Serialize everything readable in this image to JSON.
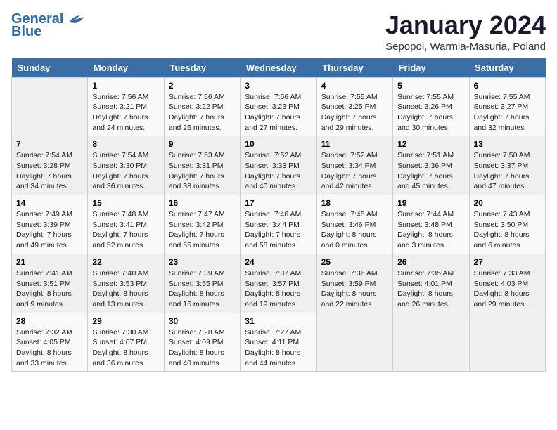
{
  "header": {
    "logo_line1": "General",
    "logo_line2": "Blue",
    "title": "January 2024",
    "subtitle": "Sepopol, Warmia-Masuria, Poland"
  },
  "days_of_week": [
    "Sunday",
    "Monday",
    "Tuesday",
    "Wednesday",
    "Thursday",
    "Friday",
    "Saturday"
  ],
  "weeks": [
    [
      {
        "day": "",
        "info": ""
      },
      {
        "day": "1",
        "info": "Sunrise: 7:56 AM\nSunset: 3:21 PM\nDaylight: 7 hours\nand 24 minutes."
      },
      {
        "day": "2",
        "info": "Sunrise: 7:56 AM\nSunset: 3:22 PM\nDaylight: 7 hours\nand 26 minutes."
      },
      {
        "day": "3",
        "info": "Sunrise: 7:56 AM\nSunset: 3:23 PM\nDaylight: 7 hours\nand 27 minutes."
      },
      {
        "day": "4",
        "info": "Sunrise: 7:55 AM\nSunset: 3:25 PM\nDaylight: 7 hours\nand 29 minutes."
      },
      {
        "day": "5",
        "info": "Sunrise: 7:55 AM\nSunset: 3:26 PM\nDaylight: 7 hours\nand 30 minutes."
      },
      {
        "day": "6",
        "info": "Sunrise: 7:55 AM\nSunset: 3:27 PM\nDaylight: 7 hours\nand 32 minutes."
      }
    ],
    [
      {
        "day": "7",
        "info": "Sunrise: 7:54 AM\nSunset: 3:28 PM\nDaylight: 7 hours\nand 34 minutes."
      },
      {
        "day": "8",
        "info": "Sunrise: 7:54 AM\nSunset: 3:30 PM\nDaylight: 7 hours\nand 36 minutes."
      },
      {
        "day": "9",
        "info": "Sunrise: 7:53 AM\nSunset: 3:31 PM\nDaylight: 7 hours\nand 38 minutes."
      },
      {
        "day": "10",
        "info": "Sunrise: 7:52 AM\nSunset: 3:33 PM\nDaylight: 7 hours\nand 40 minutes."
      },
      {
        "day": "11",
        "info": "Sunrise: 7:52 AM\nSunset: 3:34 PM\nDaylight: 7 hours\nand 42 minutes."
      },
      {
        "day": "12",
        "info": "Sunrise: 7:51 AM\nSunset: 3:36 PM\nDaylight: 7 hours\nand 45 minutes."
      },
      {
        "day": "13",
        "info": "Sunrise: 7:50 AM\nSunset: 3:37 PM\nDaylight: 7 hours\nand 47 minutes."
      }
    ],
    [
      {
        "day": "14",
        "info": "Sunrise: 7:49 AM\nSunset: 3:39 PM\nDaylight: 7 hours\nand 49 minutes."
      },
      {
        "day": "15",
        "info": "Sunrise: 7:48 AM\nSunset: 3:41 PM\nDaylight: 7 hours\nand 52 minutes."
      },
      {
        "day": "16",
        "info": "Sunrise: 7:47 AM\nSunset: 3:42 PM\nDaylight: 7 hours\nand 55 minutes."
      },
      {
        "day": "17",
        "info": "Sunrise: 7:46 AM\nSunset: 3:44 PM\nDaylight: 7 hours\nand 58 minutes."
      },
      {
        "day": "18",
        "info": "Sunrise: 7:45 AM\nSunset: 3:46 PM\nDaylight: 8 hours\nand 0 minutes."
      },
      {
        "day": "19",
        "info": "Sunrise: 7:44 AM\nSunset: 3:48 PM\nDaylight: 8 hours\nand 3 minutes."
      },
      {
        "day": "20",
        "info": "Sunrise: 7:43 AM\nSunset: 3:50 PM\nDaylight: 8 hours\nand 6 minutes."
      }
    ],
    [
      {
        "day": "21",
        "info": "Sunrise: 7:41 AM\nSunset: 3:51 PM\nDaylight: 8 hours\nand 9 minutes."
      },
      {
        "day": "22",
        "info": "Sunrise: 7:40 AM\nSunset: 3:53 PM\nDaylight: 8 hours\nand 13 minutes."
      },
      {
        "day": "23",
        "info": "Sunrise: 7:39 AM\nSunset: 3:55 PM\nDaylight: 8 hours\nand 16 minutes."
      },
      {
        "day": "24",
        "info": "Sunrise: 7:37 AM\nSunset: 3:57 PM\nDaylight: 8 hours\nand 19 minutes."
      },
      {
        "day": "25",
        "info": "Sunrise: 7:36 AM\nSunset: 3:59 PM\nDaylight: 8 hours\nand 22 minutes."
      },
      {
        "day": "26",
        "info": "Sunrise: 7:35 AM\nSunset: 4:01 PM\nDaylight: 8 hours\nand 26 minutes."
      },
      {
        "day": "27",
        "info": "Sunrise: 7:33 AM\nSunset: 4:03 PM\nDaylight: 8 hours\nand 29 minutes."
      }
    ],
    [
      {
        "day": "28",
        "info": "Sunrise: 7:32 AM\nSunset: 4:05 PM\nDaylight: 8 hours\nand 33 minutes."
      },
      {
        "day": "29",
        "info": "Sunrise: 7:30 AM\nSunset: 4:07 PM\nDaylight: 8 hours\nand 36 minutes."
      },
      {
        "day": "30",
        "info": "Sunrise: 7:28 AM\nSunset: 4:09 PM\nDaylight: 8 hours\nand 40 minutes."
      },
      {
        "day": "31",
        "info": "Sunrise: 7:27 AM\nSunset: 4:11 PM\nDaylight: 8 hours\nand 44 minutes."
      },
      {
        "day": "",
        "info": ""
      },
      {
        "day": "",
        "info": ""
      },
      {
        "day": "",
        "info": ""
      }
    ]
  ]
}
